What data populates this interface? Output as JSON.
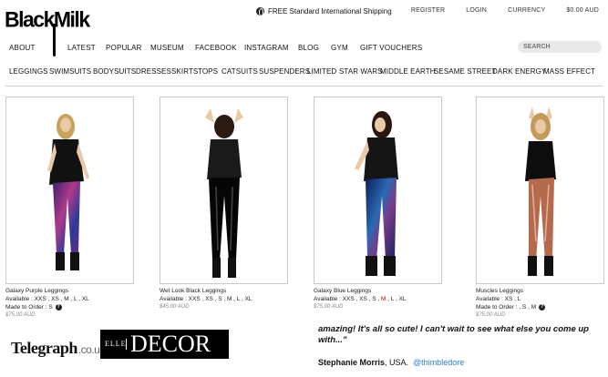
{
  "brand": {
    "logo": "BlackMilk"
  },
  "shipping_text": "FREE Standard International Shipping",
  "top_links": [
    "REGISTER",
    "LOGIN",
    "CURRENCY",
    "$0.00 AUD"
  ],
  "main_nav": [
    "ABOUT",
    "LATEST",
    "POPULAR",
    "MUSEUM",
    "FACEBOOK",
    "INSTAGRAM",
    "BLOG",
    "GYM",
    "GIFT VOUCHERS"
  ],
  "search": {
    "placeholder": "SEARCH"
  },
  "category_nav": [
    "LEGGINGS",
    "SWIMSUITS",
    "BODYSUITS",
    "DRESSES",
    "SKIRTS",
    "TOPS",
    "CATSUITS",
    "SUSPENDERS",
    "LIMITED",
    "STAR WARS",
    "MIDDLE EARTH",
    "SESAME STREET",
    "DARK ENERGY",
    "MASS EFFECT"
  ],
  "products": [
    {
      "name": "Galaxy Purple Leggings",
      "available": "Available : XXS , XS , M , L , XL",
      "order": "Made to Order : S",
      "price": "$75.00 AUD"
    },
    {
      "name": "Wet Look Black Leggings",
      "available": "Available : XXS , XS , S , M , L , XL",
      "order": "",
      "price": "$45.00 AUD"
    },
    {
      "name": "Galaxy Blue Leggings",
      "available_pre": "Available : XXS , XS , S , ",
      "available_hl": "M",
      "available_post": " , L , XL",
      "order": "",
      "price": "$75.00 AUD"
    },
    {
      "name": "Muscles Leggings",
      "available": "Available : XS , L",
      "order": "Made to Order : , S , M",
      "price": "$75.00 AUD"
    }
  ],
  "press": {
    "telegraph": "Telegraph",
    "telegraph_suffix": ".co.uk",
    "elle": "ELLE",
    "decor": "DECOR"
  },
  "testimonial": {
    "text": "amazing! It's all so cute! I can't wait to see what else you come up with...\"",
    "author": "Stephanie Morris",
    "location": ", USA.",
    "handle": "@thimbledore"
  },
  "colors": {
    "accent_link": "#2a7fc9",
    "stock_highlight": "#cc0000"
  }
}
